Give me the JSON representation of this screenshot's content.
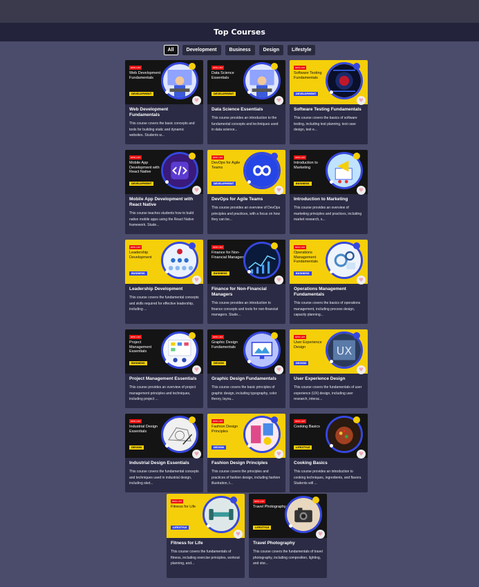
{
  "page_title": "Top Courses",
  "filters": [
    {
      "label": "All",
      "active": true
    },
    {
      "label": "Development",
      "active": false
    },
    {
      "label": "Business",
      "active": false
    },
    {
      "label": "Design",
      "active": false
    },
    {
      "label": "Lifestyle",
      "active": false
    }
  ],
  "new_tag": "NEW LIST",
  "courses": [
    {
      "thumb_title": "Web Development Fundamentals",
      "category": "DEVELOPMENT",
      "theme": "dark",
      "art": "person",
      "title": "Web Development Fundamentals",
      "desc": "This course covers the basic concepts and tools for building static and dynamic websites. Students w..."
    },
    {
      "thumb_title": "Data Science Essentials",
      "category": "DEVELOPMENT",
      "theme": "dark",
      "art": "person",
      "title": "Data Science Essentials",
      "desc": "This course provides an introduction to the fundamental concepts and techniques used in data science..."
    },
    {
      "thumb_title": "Software Testing Fundamentals",
      "category": "DEVELOPMENT",
      "theme": "yellow",
      "art": "code",
      "title": "Software Testing Fundamentals",
      "desc": "This course covers the basics of software testing, including test planning, test case design, test e..."
    },
    {
      "thumb_title": "Mobile App Development with React Native",
      "category": "DEVELOPMENT",
      "theme": "dark",
      "art": "code-tag",
      "title": "Mobile App Development with React Native",
      "desc": "This course teaches students how to build native mobile apps using the React Native framework. Stude..."
    },
    {
      "thumb_title": "DevOps for Agile Teams",
      "category": "DEVELOPMENT",
      "theme": "yellow",
      "art": "infinity",
      "title": "DevOps for Agile Teams",
      "desc": "This course provides an overview of DevOps principles and practices, with a focus on how they can be..."
    },
    {
      "thumb_title": "Introduction to Marketing",
      "category": "BUSINESS",
      "theme": "dark",
      "art": "marketing",
      "title": "Introduction to Marketing",
      "desc": "This course provides an overview of marketing principles and practices, including market research, s..."
    },
    {
      "thumb_title": "Leadership Development",
      "category": "BUSINESS",
      "theme": "yellow",
      "art": "people",
      "title": "Leadership Development",
      "desc": "This course covers the fundamental concepts and skills required for effective leadership, including ..."
    },
    {
      "thumb_title": "Finance for Non-Financial Managers",
      "category": "BUSINESS",
      "theme": "dark",
      "art": "finance",
      "title": "Finance for Non-Financial Managers",
      "desc": "This course provides an introduction to finance concepts and tools for non-financial managers. Stude..."
    },
    {
      "thumb_title": "Operations Management Fundamentals",
      "category": "BUSINESS",
      "theme": "yellow",
      "art": "gears",
      "title": "Operations Management Fundamentals",
      "desc": "This course covers the basics of operations management, including process design, capacity planning..."
    },
    {
      "thumb_title": "Project Management Essentials",
      "category": "BUSINESS",
      "theme": "dark",
      "art": "board",
      "title": "Project Management Essentials",
      "desc": "This course provides an overview of project management principles and techniques, including project ..."
    },
    {
      "thumb_title": "Graphic Design Fundamentals",
      "category": "DESIGN",
      "theme": "dark",
      "art": "monitor",
      "title": "Graphic Design Fundamentals",
      "desc": "This course covers the basic principles of graphic design, including typography, color theory, layou..."
    },
    {
      "thumb_title": "User Experience Design",
      "category": "DESIGN",
      "theme": "yellow",
      "art": "ux",
      "title": "User Experience Design",
      "desc": "This course covers the fundamentals of user experience (UX) design, including user research, interac..."
    },
    {
      "thumb_title": "Industrial Design Essentials",
      "category": "DESIGN",
      "theme": "dark",
      "art": "sketch",
      "title": "Industrial Design Essentials",
      "desc": "This course covers the fundamental concepts and techniques used in industrial design, including sket..."
    },
    {
      "thumb_title": "Fashion Design Principles",
      "category": "DESIGN",
      "theme": "yellow",
      "art": "fashion",
      "title": "Fashion Design Principles",
      "desc": "This course covers the principles and practices of fashion design, including fashion illustration, t..."
    },
    {
      "thumb_title": "Cooking Basics",
      "category": "LIFESTYLE",
      "theme": "dark",
      "art": "food",
      "title": "Cooking Basics",
      "desc": "This course provides an introduction to cooking techniques, ingredients, and flavors. Students will ..."
    },
    {
      "thumb_title": "Fitness for Life",
      "category": "LIFESTYLE",
      "theme": "yellow",
      "art": "fitness",
      "title": "Fitness for Life",
      "desc": "This course covers the fundamentals of fitness, including exercise principles, workout planning, and..."
    },
    {
      "thumb_title": "Travel Photography",
      "category": "LIFESTYLE",
      "theme": "dark",
      "art": "camera",
      "title": "Travel Photography",
      "desc": "This course covers the fundamentals of travel photography, including composition, lighting, and stor..."
    }
  ]
}
